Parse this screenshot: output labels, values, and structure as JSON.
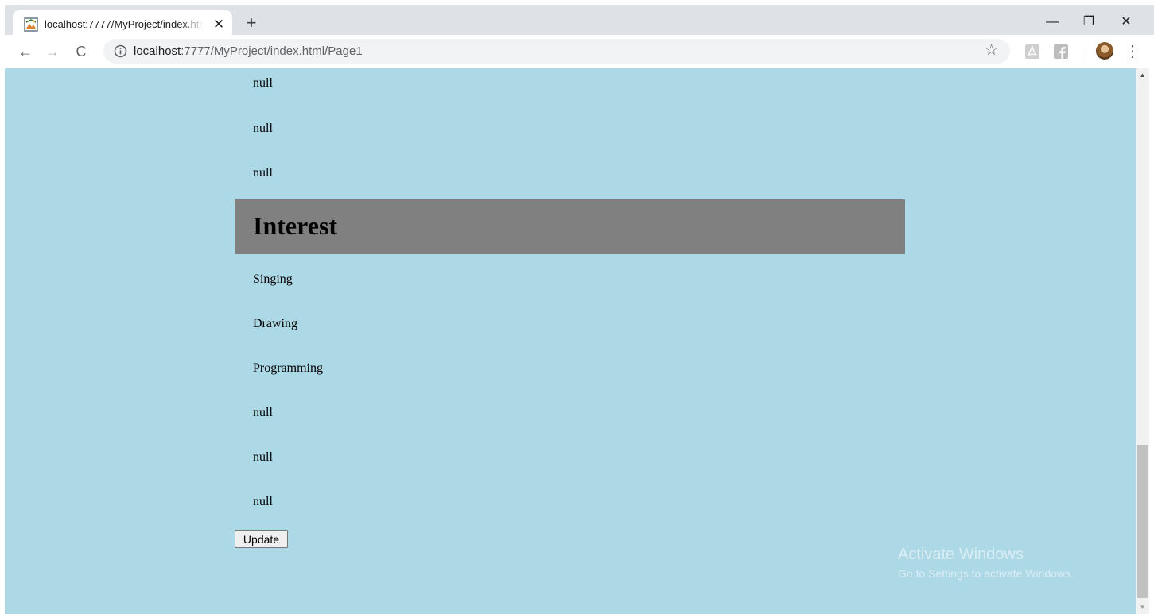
{
  "browser": {
    "tab": {
      "title": "localhost:7777/MyProject/index.html/Page1",
      "close": "✕"
    },
    "new_tab": "+",
    "window_controls": {
      "minimize": "—",
      "restore": "❐",
      "close": "✕"
    },
    "nav": {
      "back": "←",
      "forward": "→",
      "reload": "C"
    },
    "address": {
      "host": "localhost",
      "rest": ":7777/MyProject/index.html/Page1"
    },
    "bookmark_star": "☆",
    "menu": "⋮"
  },
  "page": {
    "items_top": [
      "null",
      "null",
      "null"
    ],
    "section_heading": "Interest",
    "interests": [
      "Singing",
      "Drawing",
      "Programming",
      "null",
      "null",
      "null"
    ],
    "update_button": "Update"
  },
  "watermark": {
    "title": "Activate Windows",
    "subtitle": "Go to Settings to activate Windows."
  },
  "scrollbar": {
    "up": "▲",
    "down": "▼"
  },
  "colors": {
    "page_background": "#add8e6",
    "heading_background": "#808080",
    "tabstrip": "#dee1e6",
    "omnibox": "#f1f3f4"
  }
}
